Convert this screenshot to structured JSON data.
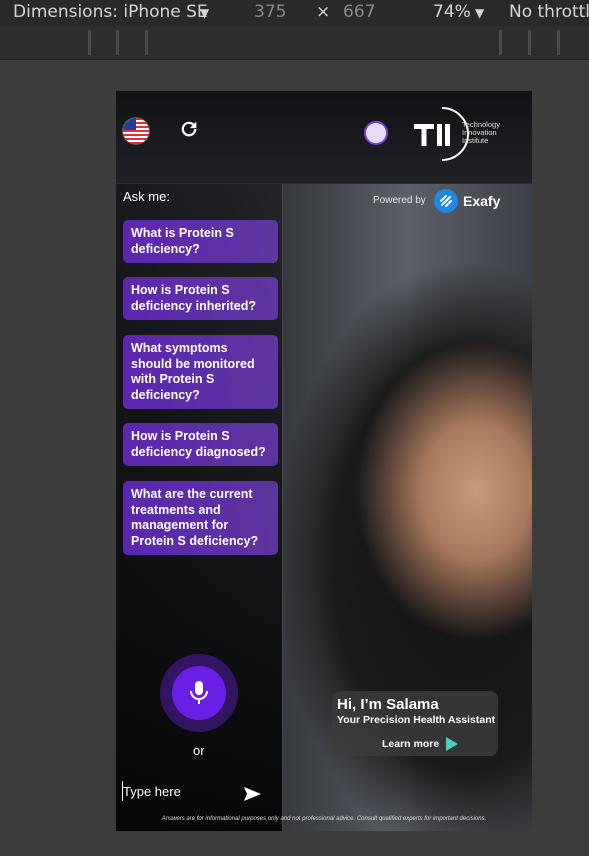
{
  "devtools": {
    "dimensions_label": "Dimensions: iPhone SE",
    "width": "375",
    "times": "×",
    "height": "667",
    "zoom": "74%",
    "throttle": "No throttl"
  },
  "header": {
    "tii_lines": [
      "Technology",
      "Innovation",
      "Institute"
    ]
  },
  "panel": {
    "ask_label": "Ask me:",
    "powered_by": "Powered by",
    "brand": "Exafy"
  },
  "questions": [
    "What is Protein S deficiency?",
    "How is Protein S deficiency inherited?",
    "What symptoms should be monitored with Protein S deficiency?",
    "How is Protein S deficiency diagnosed?",
    "What are the current treatments and management for Protein S deficiency?"
  ],
  "voice": {
    "or_label": "or"
  },
  "input": {
    "placeholder": "Type here"
  },
  "disclaimer": "Answers are for informational purposes only and not professional advice. Consult qualified experts for important decisions.",
  "greeting": {
    "title": "Hi, I’m Salama",
    "subtitle": "Your Precision Health Assistant",
    "learn_more": "Learn more"
  },
  "colors": {
    "accent": "#6a1fe6",
    "question_bg": "#5f28b9",
    "exafy_blue": "#1e88e5",
    "learn_arrow": "#4dd0c0"
  }
}
